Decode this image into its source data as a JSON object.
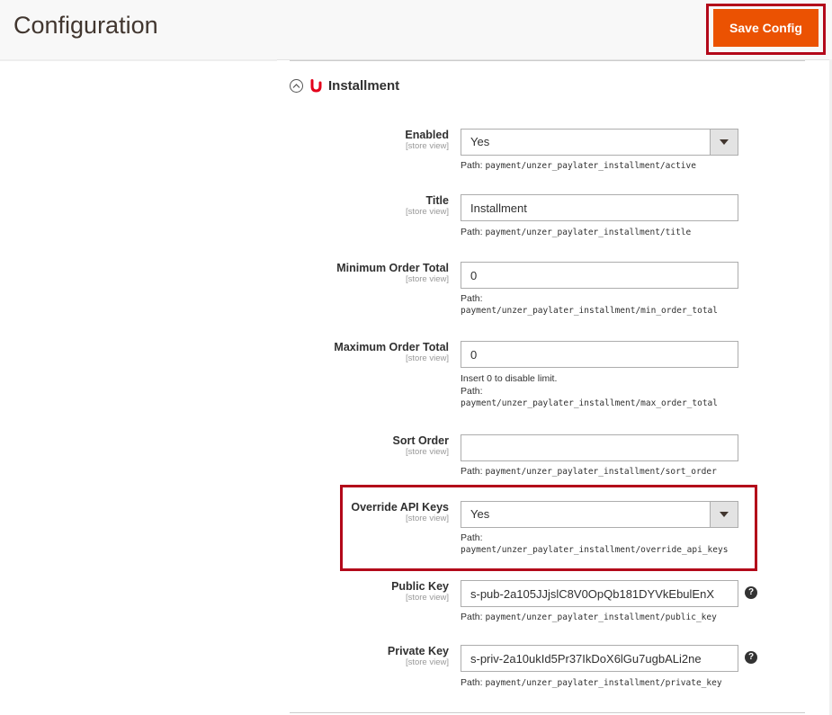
{
  "header": {
    "title": "Configuration",
    "save_label": "Save Config"
  },
  "section": {
    "title": "Installment",
    "collapse_icon": "collapse-circle-icon",
    "brand_icon": "unzer-logo-icon"
  },
  "fields": {
    "enabled": {
      "label": "Enabled",
      "scope": "[store view]",
      "value": "Yes",
      "path_label": "Path:",
      "path": "payment/unzer_paylater_installment/active"
    },
    "title": {
      "label": "Title",
      "scope": "[store view]",
      "value": "Installment",
      "path_label": "Path:",
      "path": "payment/unzer_paylater_installment/title"
    },
    "min_order_total": {
      "label": "Minimum Order Total",
      "scope": "[store view]",
      "value": "0",
      "path_label": "Path:",
      "path": "payment/unzer_paylater_installment/min_order_total"
    },
    "max_order_total": {
      "label": "Maximum Order Total",
      "scope": "[store view]",
      "value": "0",
      "hint": "Insert 0 to disable limit.",
      "path_label": "Path:",
      "path": "payment/unzer_paylater_installment/max_order_total"
    },
    "sort_order": {
      "label": "Sort Order",
      "scope": "[store view]",
      "value": "",
      "path_label": "Path:",
      "path": "payment/unzer_paylater_installment/sort_order"
    },
    "override_api_keys": {
      "label": "Override API Keys",
      "scope": "[store view]",
      "value": "Yes",
      "path_label": "Path:",
      "path": "payment/unzer_paylater_installment/override_api_keys"
    },
    "public_key": {
      "label": "Public Key",
      "scope": "[store view]",
      "value": "s-pub-2a105JJjslC8V0OpQb181DYVkEbulEnX",
      "path_label": "Path:",
      "path": "payment/unzer_paylater_installment/public_key",
      "help": "?"
    },
    "private_key": {
      "label": "Private Key",
      "scope": "[store view]",
      "value": "s-priv-2a10ukId5Pr37IkDoX6lGu7ugbALi2ne",
      "path_label": "Path:",
      "path": "payment/unzer_paylater_installment/private_key",
      "help": "?"
    }
  },
  "colors": {
    "accent": "#eb5202",
    "highlight": "#b3081a",
    "brand": "#e3001b"
  }
}
